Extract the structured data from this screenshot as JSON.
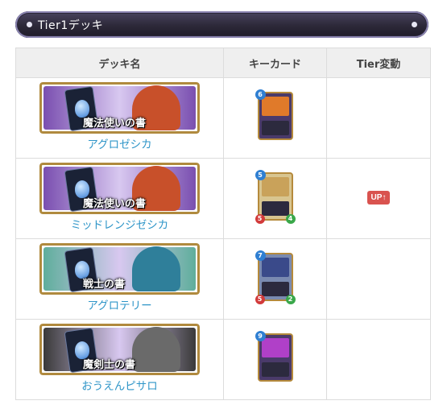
{
  "header": {
    "title": "Tier1デッキ"
  },
  "table": {
    "columns": [
      "デッキ名",
      "キーカード",
      "Tier変動"
    ],
    "rows": [
      {
        "banner_label": "魔法使いの書",
        "deck_name": "アグロゼシカ",
        "banner_color": "#7a4fb0",
        "card_art_color": "#e07a2a",
        "card_cost": "6",
        "card_atk": "",
        "card_hp": "",
        "tier_change": ""
      },
      {
        "banner_label": "魔法使いの書",
        "deck_name": "ミッドレンジゼシカ",
        "banner_color": "#7a4fb0",
        "card_art_color": "#c9a25a",
        "card_cost": "5",
        "card_atk": "5",
        "card_hp": "4",
        "tier_change": "UP↑"
      },
      {
        "banner_label": "戦士の書",
        "deck_name": "アグロテリー",
        "banner_color": "#5fae9c",
        "card_art_color": "#3a4a8a",
        "card_cost": "7",
        "card_atk": "5",
        "card_hp": "2",
        "tier_change": ""
      },
      {
        "banner_label": "魔剣士の書",
        "deck_name": "おうえんピサロ",
        "banner_color": "#3a3a3a",
        "card_art_color": "#b040c8",
        "card_cost": "9",
        "card_atk": "",
        "card_hp": "",
        "tier_change": ""
      }
    ]
  }
}
